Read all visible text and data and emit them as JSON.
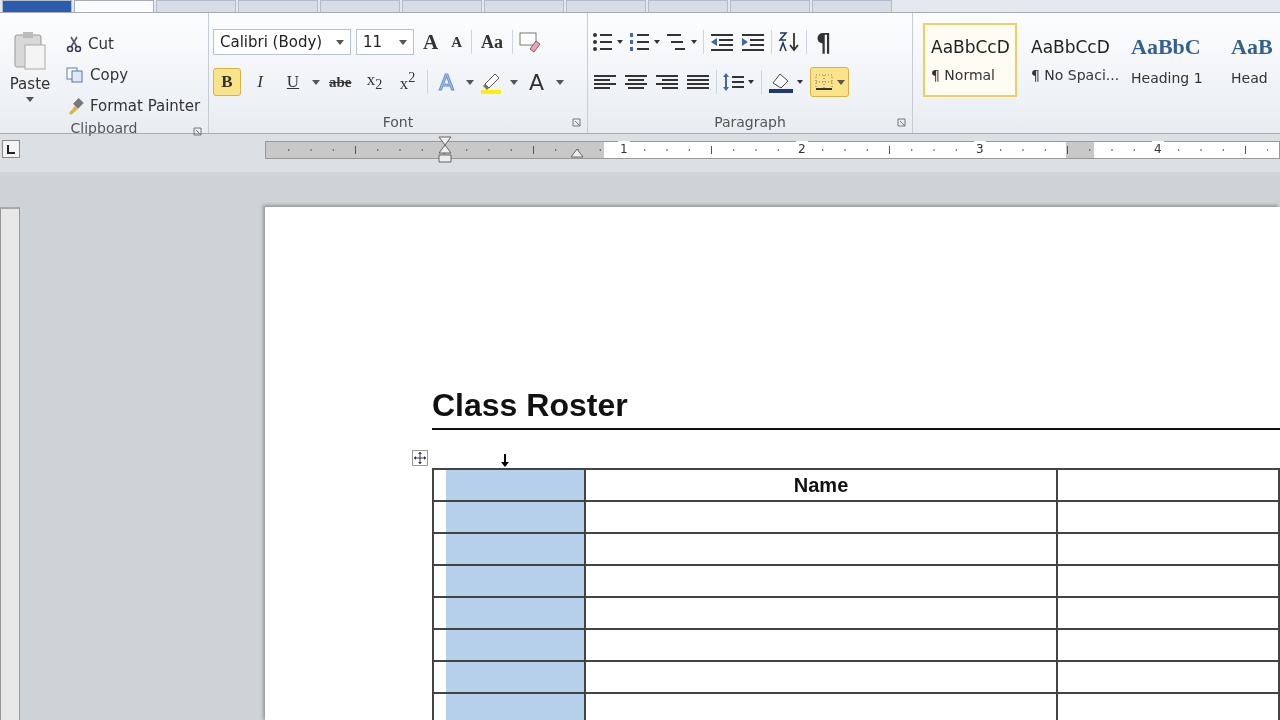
{
  "ribbon": {
    "tabs": [
      {
        "kind": "file",
        "selected": false
      },
      {
        "kind": "tab",
        "selected": true
      },
      {
        "kind": "tab",
        "selected": false
      },
      {
        "kind": "tab",
        "selected": false
      },
      {
        "kind": "tab",
        "selected": false
      },
      {
        "kind": "tab",
        "selected": false
      },
      {
        "kind": "tab",
        "selected": false
      },
      {
        "kind": "tab",
        "selected": false
      },
      {
        "kind": "tab",
        "selected": false
      },
      {
        "kind": "tab",
        "selected": false
      },
      {
        "kind": "tab",
        "selected": false
      }
    ],
    "clipboard": {
      "paste": "Paste",
      "cut": "Cut",
      "copy": "Copy",
      "format_painter": "Format Painter",
      "label": "Clipboard"
    },
    "font": {
      "font_name": "Calibri (Body)",
      "font_size": "11",
      "grow": "A",
      "shrink": "A",
      "change_case": "Aa",
      "bold": {
        "label": "B",
        "selected": true
      },
      "italic": {
        "label": "I",
        "selected": false
      },
      "underline": {
        "label": "U",
        "selected": false
      },
      "strikethrough": "abe",
      "subscript": "x$_{2}$",
      "superscript": "x$^{2}$",
      "text_effects": "A",
      "font_color": "A",
      "label": "Font"
    },
    "paragraph": {
      "show_marks": "¶",
      "borders": {
        "selected": true
      },
      "label": "Paragraph"
    },
    "styles": [
      {
        "preview": "AaBbCcD",
        "name": "¶ Normal",
        "kind": "normal",
        "selected": true
      },
      {
        "preview": "AaBbCcD",
        "name": "¶ No Spaci...",
        "kind": "normal",
        "selected": false
      },
      {
        "preview": "AaBbC",
        "name": "Heading 1",
        "kind": "heading",
        "selected": false
      },
      {
        "preview": "AaB",
        "name": "Head",
        "kind": "heading",
        "selected": false
      }
    ]
  },
  "ruler": {
    "numbers": [
      "1",
      "2",
      "3",
      "4"
    ]
  },
  "document": {
    "title": "Class Roster",
    "table": {
      "columns": [
        {
          "selected": true
        },
        {
          "heading": "Name",
          "selected": false
        },
        {
          "selected": false
        }
      ]
    }
  }
}
